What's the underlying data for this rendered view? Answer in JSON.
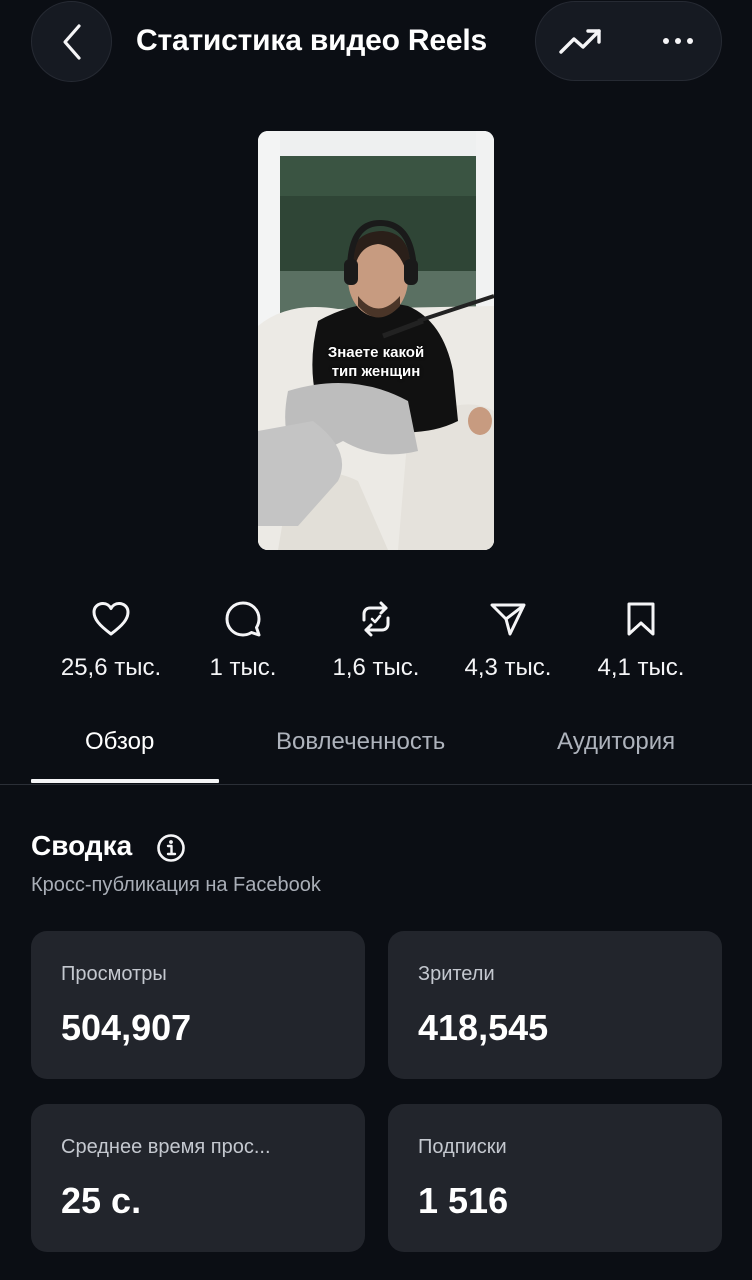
{
  "header": {
    "title": "Статистика видео Reels",
    "back_icon": "chevron-left-icon",
    "trend_icon": "trending-up-icon",
    "more_icon": "more-horizontal-icon"
  },
  "reel": {
    "caption_line1": "Знаете какой",
    "caption_line2": "тип женщин"
  },
  "stats": [
    {
      "icon": "heart-icon",
      "value": "25,6 тыс."
    },
    {
      "icon": "comment-icon",
      "value": "1 тыс."
    },
    {
      "icon": "repost-icon",
      "value": "1,6 тыс."
    },
    {
      "icon": "share-icon",
      "value": "4,3 тыс."
    },
    {
      "icon": "bookmark-icon",
      "value": "4,1 тыс."
    }
  ],
  "tabs": [
    {
      "label": "Обзор",
      "active": true
    },
    {
      "label": "Вовлеченность",
      "active": false
    },
    {
      "label": "Аудитория",
      "active": false
    }
  ],
  "summary": {
    "title": "Сводка",
    "subtitle": "Кросс-публикация на Facebook"
  },
  "cards": [
    {
      "label": "Просмотры",
      "value": "504,907"
    },
    {
      "label": "Зрители",
      "value": "418,545"
    },
    {
      "label": "Среднее время прос...",
      "value": "25 с."
    },
    {
      "label": "Подписки",
      "value": "1 516"
    }
  ],
  "colors": {
    "background": "#0b0e14",
    "card": "#22252c",
    "text_primary": "#ffffff",
    "text_secondary": "#a9aeb7"
  }
}
